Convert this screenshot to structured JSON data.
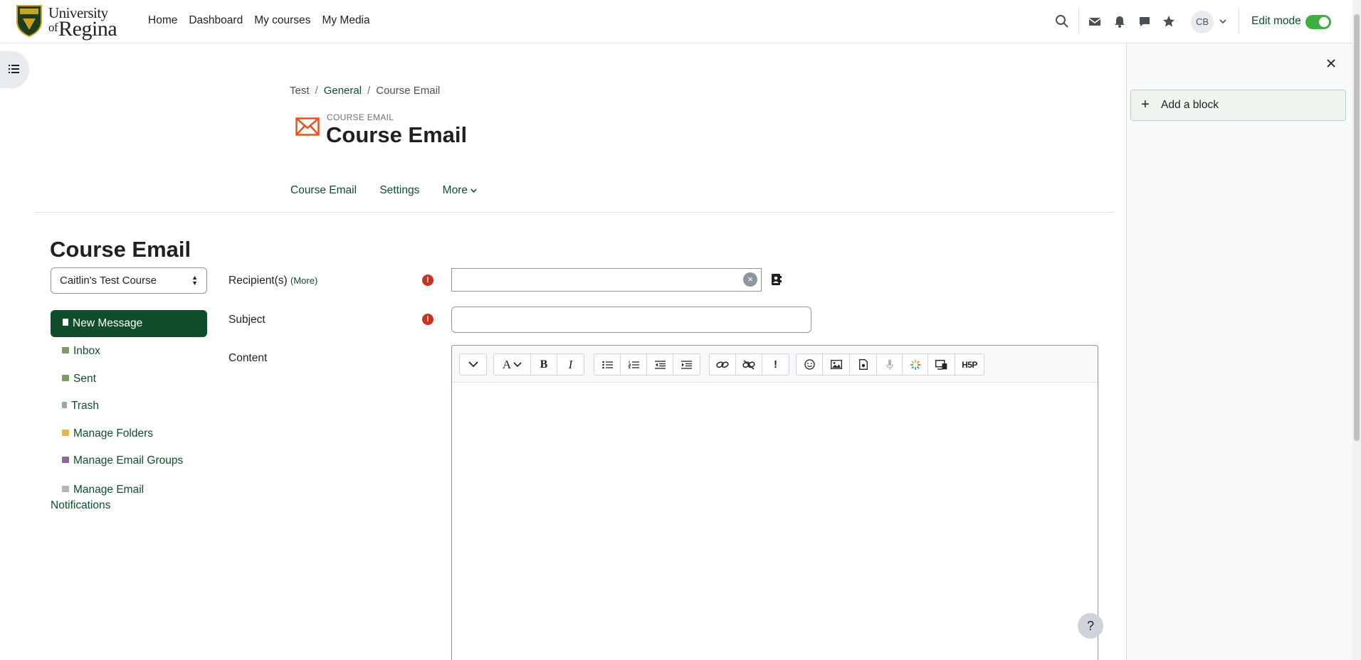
{
  "brand": {
    "line1": "University",
    "line2_small": "of",
    "line2": "Regina"
  },
  "primary_nav": [
    "Home",
    "Dashboard",
    "My courses",
    "My Media"
  ],
  "user": {
    "initials": "CB"
  },
  "edit_mode": {
    "label": "Edit mode",
    "on": true
  },
  "colors": {
    "brand_green": "#0f4d2b",
    "toggle_on": "#3cb043",
    "required": "#ca3120",
    "module_icon": "#e8541c"
  },
  "block_drawer": {
    "add_block_label": "Add a block"
  },
  "breadcrumb": [
    "Test",
    "General",
    "Course Email"
  ],
  "header": {
    "pretitle": "COURSE EMAIL",
    "title": "Course Email"
  },
  "secondary_nav": {
    "course_email": "Course Email",
    "settings": "Settings",
    "more": "More"
  },
  "content": {
    "title": "Course Email",
    "course_select": "Caitlin's Test Course",
    "menu": {
      "new_message": "New Message",
      "inbox": "Inbox",
      "sent": "Sent",
      "trash": "Trash",
      "manage_folders": "Manage Folders",
      "manage_groups": "Manage Email Groups",
      "manage_notifications_1": "Manage Email",
      "manage_notifications_2": "Notifications"
    }
  },
  "form": {
    "recipients_label": "Recipient(s)",
    "recipients_more": "(More)",
    "recipients_value": "",
    "subject_label": "Subject",
    "subject_value": "",
    "content_label": "Content"
  },
  "editor_toolbar_icons": [
    "expand-icon",
    "text-style-icon",
    "bold-icon",
    "italic-icon",
    "bullet-list-icon",
    "numbered-list-icon",
    "outdent-icon",
    "indent-icon",
    "link-icon",
    "unlink-icon",
    "no-autolink-icon",
    "emoji-icon",
    "image-icon",
    "media-icon",
    "recordrtc-icon",
    "kaltura-icon",
    "screen-icon",
    "h5p-icon"
  ],
  "editor_text": {
    "h5p": "H5P"
  },
  "help": "?"
}
